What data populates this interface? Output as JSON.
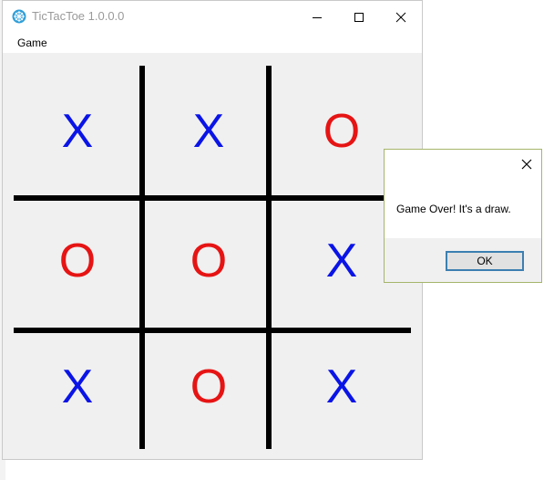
{
  "window": {
    "title": "TicTacToe 1.0.0.0",
    "icon": "globe-app-icon",
    "controls": [
      "minimize-icon",
      "maximize-icon",
      "close-icon"
    ]
  },
  "menu": {
    "items": [
      "Game"
    ]
  },
  "board": {
    "cells": [
      [
        "X",
        "X",
        "O"
      ],
      [
        "O",
        "O",
        "X"
      ],
      [
        "X",
        "O",
        "X"
      ]
    ],
    "colors": {
      "X": "#0a14e6",
      "O": "#e61414",
      "grid": "#000000"
    }
  },
  "dialog": {
    "message": "Game Over! It's a draw.",
    "ok_label": "OK",
    "close_icon": "close-icon"
  }
}
